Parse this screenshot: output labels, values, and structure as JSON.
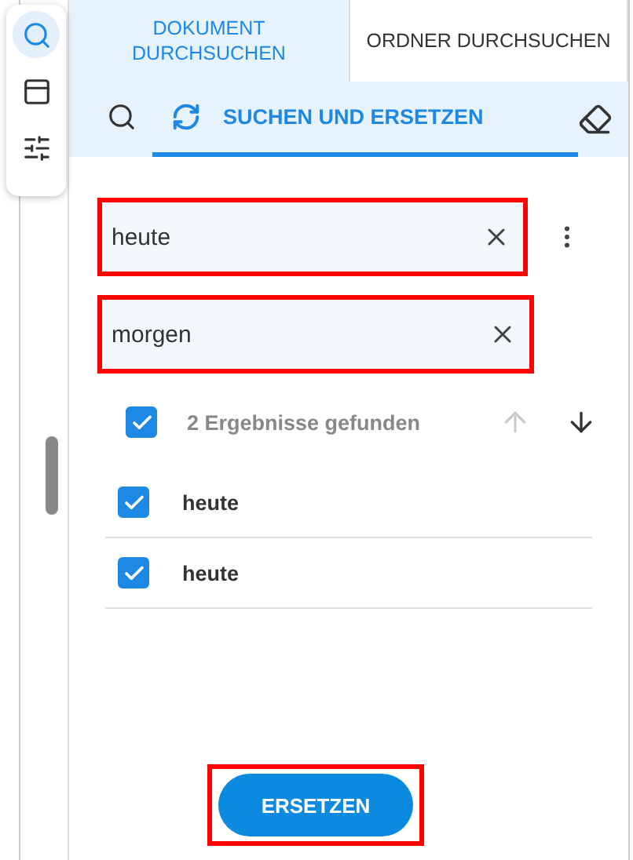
{
  "rail": {
    "items": [
      {
        "kind": "search",
        "selected": true
      },
      {
        "kind": "panel",
        "selected": false
      },
      {
        "kind": "sliders",
        "selected": false
      }
    ]
  },
  "tabs": [
    {
      "label": "DOKUMENT DURCHSUCHEN",
      "selected": true
    },
    {
      "label": "ORDNER DURCHSUCHEN",
      "selected": false
    }
  ],
  "mode_tabs": [
    {
      "kind": "search",
      "selected": false
    },
    {
      "kind": "replace",
      "label": "SUCHEN UND ERSETZEN",
      "selected": true
    }
  ],
  "search_field": {
    "value": "heute",
    "highlighted": true
  },
  "replace_field": {
    "value": "morgen",
    "highlighted": true
  },
  "results": {
    "summary": "2 Ergebnisse gefunden",
    "all_checked": true,
    "prev_disabled": true,
    "next_disabled": false,
    "items": [
      {
        "text": "heute",
        "checked": true
      },
      {
        "text": "heute",
        "checked": true
      }
    ]
  },
  "replace_button": {
    "label": "ERSETZEN",
    "highlighted": true
  }
}
